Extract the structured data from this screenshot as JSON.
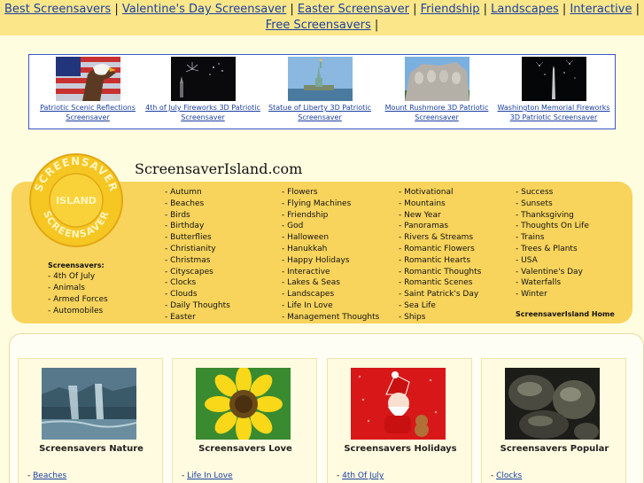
{
  "topnav": {
    "links": [
      "Best Screensavers",
      "Valentine's Day Screensaver",
      "Easter Screensaver",
      "Friendship",
      "Landscapes",
      "Interactive",
      "Free Screensavers"
    ],
    "separator": "|"
  },
  "featured": [
    {
      "title": "Patriotic Scenic Reflections Screensaver",
      "icon": "eagle-flag-image"
    },
    {
      "title": "4th of July Fireworks 3D Patriotic Screensaver",
      "icon": "fireworks-image"
    },
    {
      "title": "Statue of Liberty 3D Patriotic Screensaver",
      "icon": "statue-of-liberty-image"
    },
    {
      "title": "Mount Rushmore 3D Patriotic Screensaver",
      "icon": "mount-rushmore-image"
    },
    {
      "title": "Washington Memorial Fireworks 3D Patriotic Screensaver",
      "icon": "washington-monument-image"
    }
  ],
  "site_title": "ScreensaverIsland.com",
  "logo": {
    "top": "SCREENSAVER",
    "middle": "ISLAND",
    "bottom": "SCREENSAVER"
  },
  "left_list": {
    "header": "Screensavers:",
    "items": [
      "- 4th Of July",
      "- Animals",
      "- Armed Forces",
      "- Automobiles"
    ]
  },
  "categories": [
    [
      "- Autumn",
      "- Beaches",
      "- Birds",
      "- Birthday",
      "- Butterflies",
      "- Christianity",
      "- Christmas",
      "- Cityscapes",
      "- Clocks",
      "- Clouds",
      "- Daily Thoughts",
      "- Easter"
    ],
    [
      "- Flowers",
      "- Flying Machines",
      "- Friendship",
      "- God",
      "- Halloween",
      "- Hanukkah",
      "- Happy Holidays",
      "- Interactive",
      "- Lakes & Seas",
      "- Landscapes",
      "- Life In Love",
      "- Management Thoughts"
    ],
    [
      "- Motivational",
      "- Mountains",
      "- New Year",
      "- Panoramas",
      "- Rivers & Streams",
      "- Romantic Flowers",
      "- Romantic Hearts",
      "- Romantic Thoughts",
      "- Romantic Scenes",
      "- Saint Patrick's Day",
      "- Sea Life",
      "- Ships"
    ],
    [
      "- Success",
      "- Sunsets",
      "- Thanksgiving",
      "- Thoughts On Life",
      "- Trains",
      "- Trees & Plants",
      "- USA",
      "- Valentine's Day",
      "- Waterfalls",
      "- Winter"
    ]
  ],
  "home_link": "ScreensaverIsland Home",
  "cards": [
    {
      "title": "Screensavers Nature",
      "link": "Beaches",
      "icon": "waterfall-image"
    },
    {
      "title": "Screensavers Love",
      "link": "Life In Love",
      "icon": "sunflower-image"
    },
    {
      "title": "Screensavers Holidays",
      "link": "4th Of July",
      "icon": "santa-image"
    },
    {
      "title": "Screensavers Popular",
      "link": "Clocks",
      "icon": "stones-image"
    }
  ],
  "colors": {
    "nav_bg": "#fbe78a",
    "panel_bg": "#f8d45c",
    "link": "#1a3fa0",
    "page_bg": "#fffde0"
  }
}
